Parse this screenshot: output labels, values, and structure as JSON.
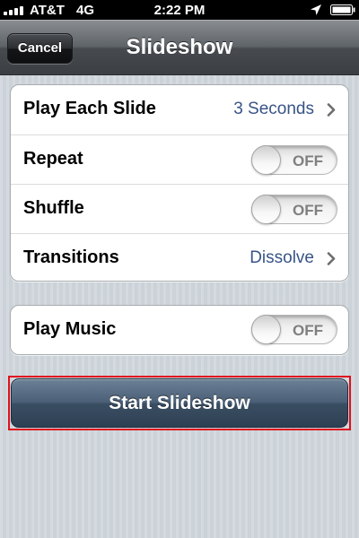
{
  "status_bar": {
    "carrier": "AT&T",
    "network": "4G",
    "time": "2:22 PM",
    "signal_bars": 4
  },
  "nav": {
    "title": "Slideshow",
    "cancel_label": "Cancel"
  },
  "settings": {
    "rows": [
      {
        "label": "Play Each Slide",
        "value": "3 Seconds"
      },
      {
        "label": "Repeat",
        "toggle": "OFF"
      },
      {
        "label": "Shuffle",
        "toggle": "OFF"
      },
      {
        "label": "Transitions",
        "value": "Dissolve"
      }
    ]
  },
  "music": {
    "label": "Play Music",
    "toggle": "OFF"
  },
  "start_label": "Start Slideshow",
  "colors": {
    "value_text": "#385487",
    "highlight_border": "#e0101d"
  }
}
